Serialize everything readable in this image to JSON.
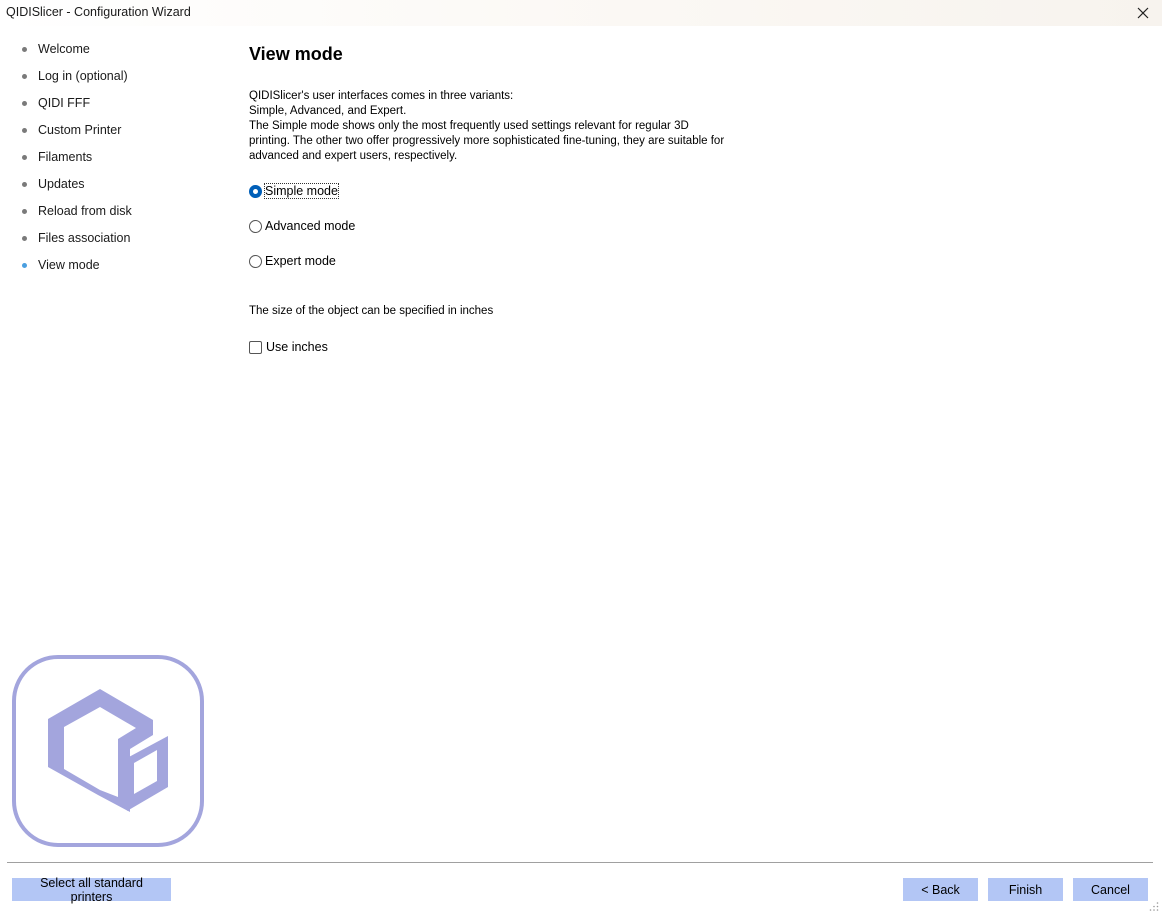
{
  "window": {
    "title": "QIDISlicer - Configuration Wizard"
  },
  "sidebar": {
    "items": [
      {
        "label": "Welcome",
        "active": false
      },
      {
        "label": "Log in (optional)",
        "active": false
      },
      {
        "label": "QIDI FFF",
        "active": false
      },
      {
        "label": "Custom Printer",
        "active": false
      },
      {
        "label": "Filaments",
        "active": false
      },
      {
        "label": "Updates",
        "active": false
      },
      {
        "label": "Reload from disk",
        "active": false
      },
      {
        "label": "Files association",
        "active": false
      },
      {
        "label": "View mode",
        "active": true
      }
    ]
  },
  "main": {
    "title": "View mode",
    "description_lines": [
      "QIDISlicer's user interfaces comes in three variants:",
      "Simple, Advanced, and Expert.",
      "The Simple mode shows only the most frequently used settings relevant for regular 3D",
      "printing. The other two offer progressively more sophisticated fine-tuning, they are suitable for",
      "advanced and expert users, respectively."
    ],
    "modes": [
      {
        "label": "Simple mode",
        "checked": true
      },
      {
        "label": "Advanced mode",
        "checked": false
      },
      {
        "label": "Expert mode",
        "checked": false
      }
    ],
    "inches_text": "The size of the object can be specified in inches",
    "use_inches": {
      "label": "Use inches",
      "checked": false
    }
  },
  "footer": {
    "select_all_label": "Select all standard printers",
    "back_label": "< Back",
    "finish_label": "Finish",
    "cancel_label": "Cancel"
  },
  "colors": {
    "button_bg": "#b3c6f5",
    "logo_color": "#a3a5dd",
    "active_dot": "#4a9fe0",
    "radio_checked": "#005fb8"
  },
  "icons": {
    "close": "close-icon",
    "logo": "qidi-logo",
    "resize_grip": "resize-grip-icon"
  }
}
